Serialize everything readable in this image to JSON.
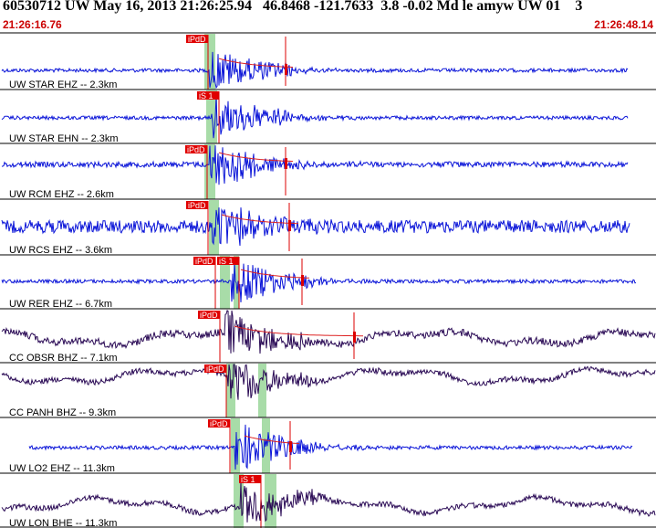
{
  "header": {
    "title": "60530712 UW May 16, 2013 21:26:25.94   46.8468 -121.7633  3.8 -0.02 Md le amyw UW 01    3",
    "start_time": "21:26:16.76",
    "end_time": "21:26:48.14"
  },
  "colors": {
    "blue_trace": "#0a14d8",
    "dark_trace": "#2a0a55",
    "pick_box": "#e00000",
    "green_window": "#a8dca8",
    "divider": "#000000"
  },
  "traces": [
    {
      "label": "UW STAR EHZ -- 2.3km",
      "picks": [
        "iPdD"
      ],
      "color": "blue"
    },
    {
      "label": "UW STAR EHN -- 2.3km",
      "picks": [
        "iS 1"
      ],
      "color": "blue"
    },
    {
      "label": "UW RCM EHZ -- 2.6km",
      "picks": [
        "iPdD"
      ],
      "color": "blue"
    },
    {
      "label": "UW RCS EHZ -- 3.6km",
      "picks": [
        "iPdD"
      ],
      "color": "blue"
    },
    {
      "label": "UW RER EHZ -- 6.7km",
      "picks": [
        "iPdD",
        "iS 1"
      ],
      "color": "blue"
    },
    {
      "label": "CC OBSR BHZ -- 7.1km",
      "picks": [
        "iPdD"
      ],
      "color": "dark"
    },
    {
      "label": "CC PANH BHZ -- 9.3km",
      "picks": [
        "iPdD"
      ],
      "color": "dark"
    },
    {
      "label": "UW LO2 EHZ -- 11.3km",
      "picks": [
        "iPdD"
      ],
      "color": "blue"
    },
    {
      "label": "UW LON BHE -- 11.3km",
      "picks": [
        "iS 1"
      ],
      "color": "dark"
    }
  ]
}
